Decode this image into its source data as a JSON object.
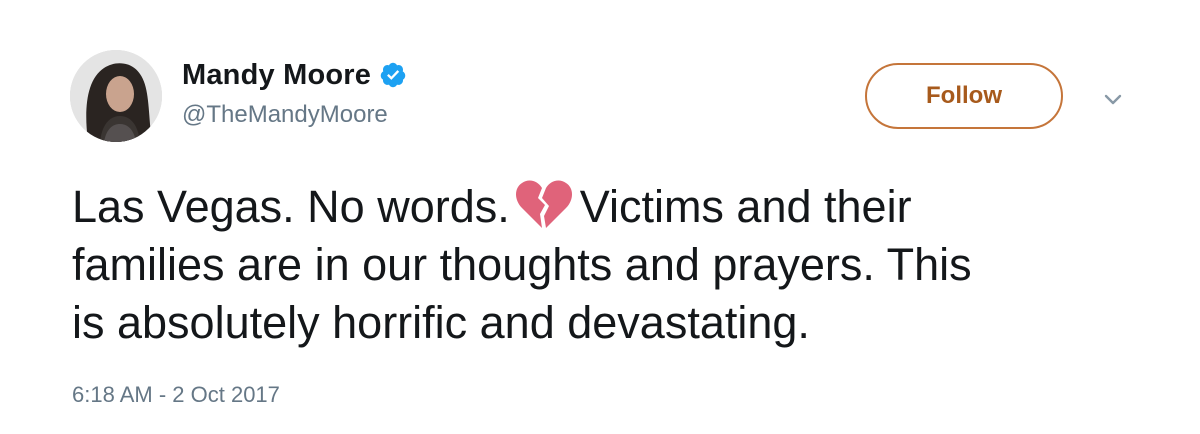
{
  "user": {
    "display_name": "Mandy Moore",
    "handle": "@TheMandyMoore",
    "verified_icon": "verified-badge-icon"
  },
  "actions": {
    "follow_label": "Follow",
    "more_icon": "chevron-down-icon"
  },
  "tweet": {
    "line1_before": "Las Vegas. No words.",
    "emoji": "broken-heart-icon",
    "line1_after": "Victims and their",
    "line2": "families are in our thoughts and prayers. This",
    "line3": "is absolutely horrific and devastating.",
    "timestamp": "6:18 AM - 2 Oct 2017"
  },
  "colors": {
    "verified_blue": "#1da1f2",
    "follow_border": "#c5753a",
    "follow_text": "#a75a1c",
    "secondary_text": "#657786",
    "broken_heart": "#e0637a"
  }
}
